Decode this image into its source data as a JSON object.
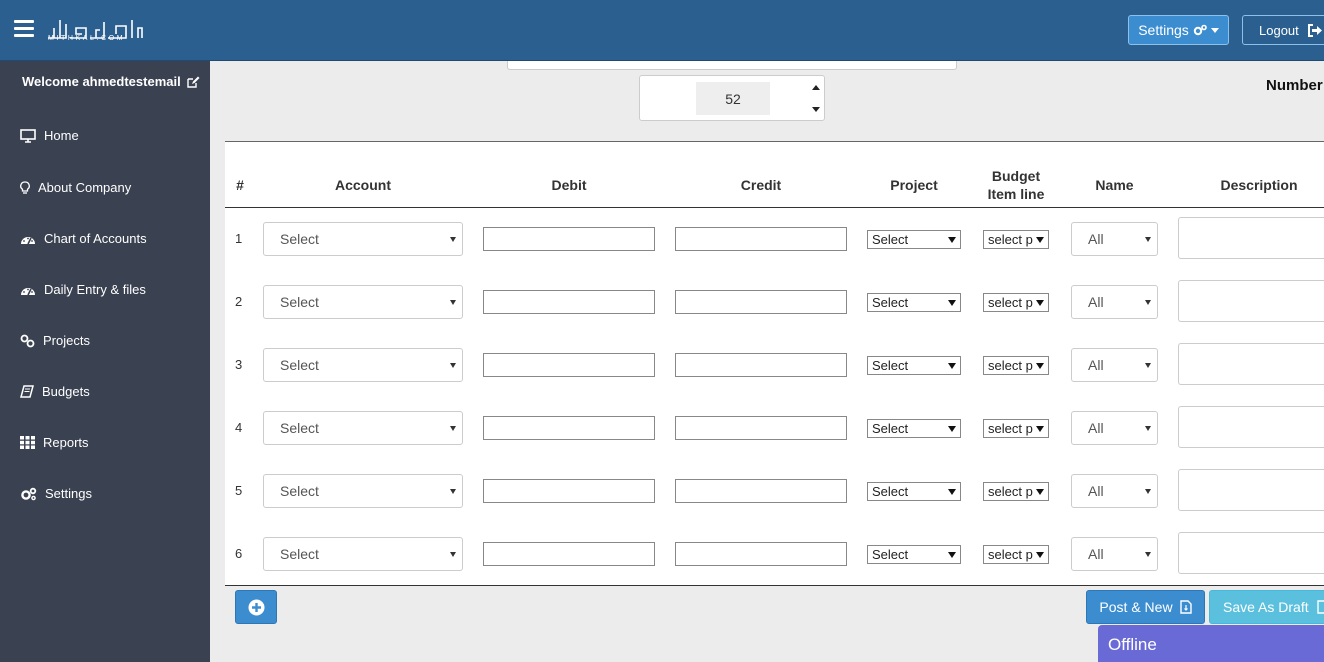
{
  "header": {
    "logo_text": "MITHKAL.COM",
    "settings_label": "Settings",
    "logout_label": "Logout"
  },
  "sidebar": {
    "welcome": "Welcome ahmedtestemail",
    "items": [
      {
        "label": "Home",
        "icon": "monitor-icon"
      },
      {
        "label": "About Company",
        "icon": "lightbulb-icon"
      },
      {
        "label": "Chart of Accounts",
        "icon": "dashboard-icon"
      },
      {
        "label": "Daily Entry & files",
        "icon": "dashboard-icon"
      },
      {
        "label": "Projects",
        "icon": "link-icon"
      },
      {
        "label": "Budgets",
        "icon": "book-icon"
      },
      {
        "label": "Reports",
        "icon": "grid-icon"
      },
      {
        "label": "Settings",
        "icon": "gears-icon"
      }
    ]
  },
  "form": {
    "number_value": "52",
    "number_label": "Number"
  },
  "table": {
    "headers": {
      "num": "#",
      "account": "Account",
      "debit": "Debit",
      "credit": "Credit",
      "project": "Project",
      "budget_line1": "Budget",
      "budget_line2": "Item line",
      "name": "Name",
      "description": "Description"
    },
    "rows": [
      {
        "num": "1",
        "account": "Select",
        "project": "Select",
        "budget": "select p",
        "name": "All"
      },
      {
        "num": "2",
        "account": "Select",
        "project": "Select",
        "budget": "select p",
        "name": "All"
      },
      {
        "num": "3",
        "account": "Select",
        "project": "Select",
        "budget": "select p",
        "name": "All"
      },
      {
        "num": "4",
        "account": "Select",
        "project": "Select",
        "budget": "select p",
        "name": "All"
      },
      {
        "num": "5",
        "account": "Select",
        "project": "Select",
        "budget": "select p",
        "name": "All"
      },
      {
        "num": "6",
        "account": "Select",
        "project": "Select",
        "budget": "select p",
        "name": "All"
      }
    ]
  },
  "actions": {
    "post_new_label": "Post & New",
    "save_draft_label": "Save As Draft"
  },
  "status": {
    "offline_label": "Offline"
  },
  "colors": {
    "header_bg": "#2a5f8f",
    "sidebar_bg": "#3a4151",
    "primary": "#3c8dd0",
    "info": "#5bc0de",
    "offline": "#6a6ad6"
  }
}
